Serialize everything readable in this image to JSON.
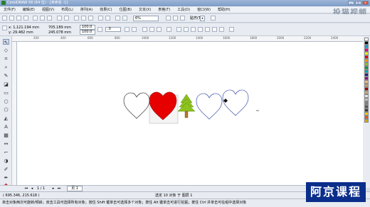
{
  "window": {
    "title": "CorelDRAW X6 (64 位) - [未命名 -1]"
  },
  "watermark": "投猫视频",
  "menu": [
    "文件(F)",
    "编辑(E)",
    "视图(V)",
    "布局(L)",
    "排列(A)",
    "效果(C)",
    "位图(B)",
    "文本(X)",
    "表格(T)",
    "工具(O)",
    "窗口(W)",
    "帮助(H)"
  ],
  "toolbar": {
    "zoom": "6%",
    "snap_label": "贴齐(T)"
  },
  "property_bar": {
    "x": "x: 1,121.194 mm",
    "y": "y: 29.482 mm",
    "w": "705.189 mm",
    "h": "245.078 mm",
    "scale_w": "100.0",
    "scale_h": "100.0",
    "rotation": ".0"
  },
  "ruler": {
    "top_ticks": [
      "200",
      "400",
      "600",
      "800",
      "1000",
      "1200",
      "1400",
      "1600",
      "1800",
      "2000",
      "2200",
      "2400"
    ]
  },
  "page_nav": {
    "counter": "1 / 1",
    "tab": "页 1"
  },
  "status": {
    "cursor": "( 695.346, 215.618 )",
    "selection": "选定 10 对象 于 图层 1"
  },
  "hint": "单击对象两次可旋转/倾斜；双击工具可选择所有对象；按住 Shift 键单击可选择多个对象；按住 Alt 键单击可进行挖掘；按住 Ctrl 并单击可在组中选择对象",
  "brand": "阿京课程",
  "colors": {
    "heart_fill": "#e60000",
    "tree_green": "#8dc21f",
    "tree_trunk": "#b5762a",
    "outline": "#333333",
    "outline_blue": "#3a4fa8"
  }
}
